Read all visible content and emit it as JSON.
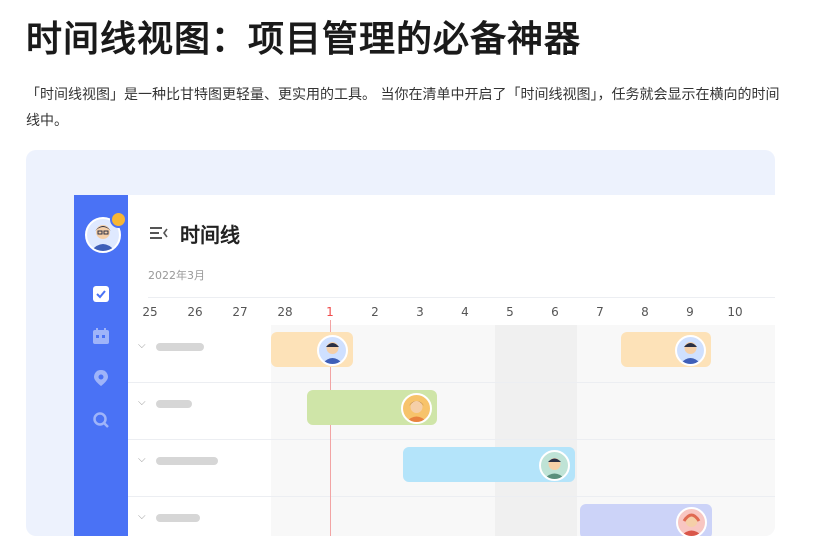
{
  "heading": "时间线视图：项目管理的必备神器",
  "description": "「时间线视图」是一种比甘特图更轻量、更实用的工具。 当你在清单中开启了「时间线视图」，任务就会显示在横向的时间线中。",
  "app": {
    "view_title": "时间线",
    "month_label": "2022年3月",
    "days": [
      "25",
      "26",
      "27",
      "28",
      "1",
      "2",
      "3",
      "4",
      "5",
      "6",
      "7",
      "8",
      "9",
      "10"
    ],
    "today": "1",
    "sidebar_icons": [
      "checkbox-icon",
      "calendar-icon",
      "location-pin-icon",
      "search-icon"
    ],
    "colors": {
      "sidebar": "#4a72f5",
      "bar_orange": "#fde2b8",
      "bar_green": "#cfe5a8",
      "bar_blue": "#b4e4fa",
      "bar_purple": "#ccd3f8",
      "today_line": "#ef4b4b"
    }
  }
}
